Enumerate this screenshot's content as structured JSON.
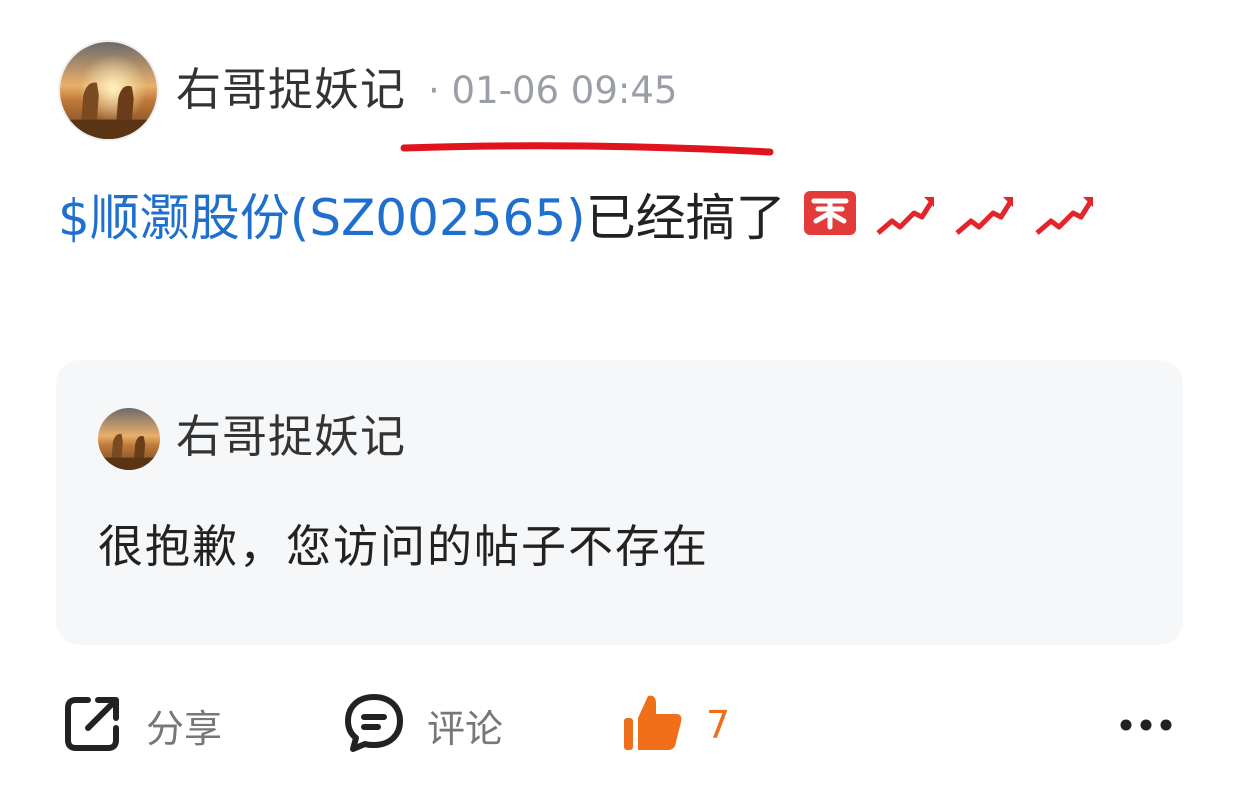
{
  "post": {
    "author": "右哥捉妖记",
    "time": "· 01-06 09:45",
    "stock_tag": "$顺灏股份(SZ002565)",
    "stock_tag_tail": "$",
    "text": "已经搞了",
    "emoji": [
      "buy-stamp-icon",
      "trend-up-icon",
      "trend-up-icon",
      "trend-up-icon"
    ]
  },
  "quote": {
    "author": "右哥捉妖记",
    "text": "很抱歉，您访问的帖子不存在"
  },
  "actions": {
    "share_label": "分享",
    "comment_label": "评论",
    "like_count": "7"
  },
  "colors": {
    "link": "#1f6fcf",
    "like": "#ef6f1a",
    "annotation": "#e0141c",
    "quote_bg": "#f6f7f9"
  }
}
